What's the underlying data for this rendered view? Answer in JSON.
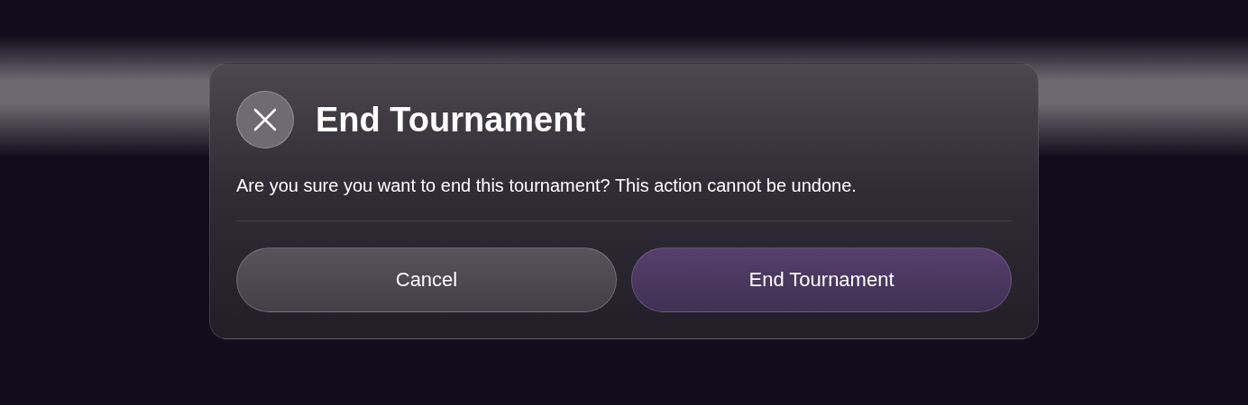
{
  "dialog": {
    "title": "End Tournament",
    "message": "Are you sure you want to end this tournament? This action cannot be undone.",
    "buttons": [
      {
        "label": "Cancel",
        "kind": "secondary"
      },
      {
        "label": "End Tournament",
        "kind": "primary"
      }
    ]
  }
}
